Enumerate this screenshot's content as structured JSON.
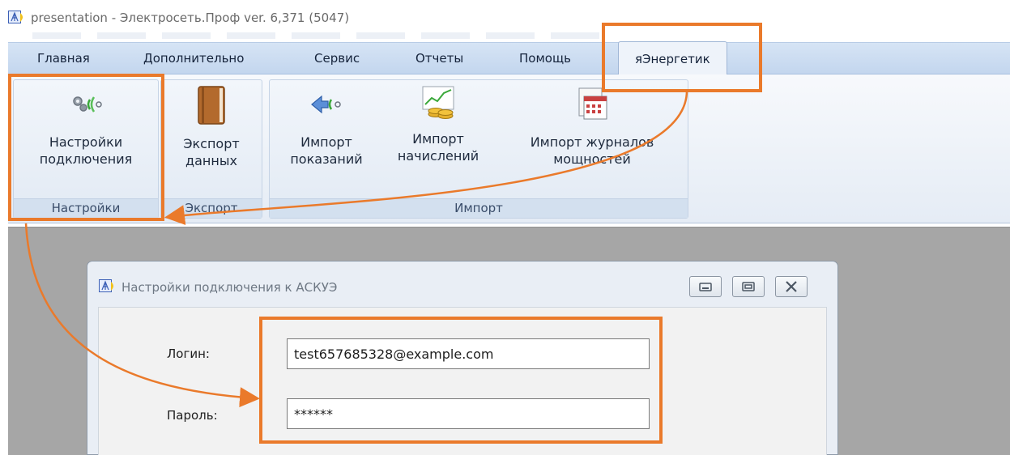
{
  "window": {
    "title": "presentation - Электросеть.Проф ver. 6,371 (5047)"
  },
  "tabs": [
    "Главная",
    "Дополнительно",
    "Сервис",
    "Отчеты",
    "Помощь",
    "яЭнергетик"
  ],
  "active_tab": "яЭнергетик",
  "ribbon": {
    "settings_group": {
      "label": "Настройки",
      "button": {
        "line1": "Настройки",
        "line2": "подключения",
        "icon": "connection-settings-icon"
      }
    },
    "export_group": {
      "label": "Экспорт",
      "button": {
        "line1": "Экспорт",
        "line2": "данных",
        "icon": "book-icon"
      }
    },
    "import_group": {
      "label": "Импорт",
      "buttons": [
        {
          "line1": "Импорт",
          "line2": "показаний",
          "icon": "import-arrow-icon"
        },
        {
          "line1": "Импорт",
          "line2": "начислений",
          "icon": "chart-coins-icon"
        },
        {
          "line1": "Импорт журналов",
          "line2": "мощностей",
          "icon": "calendar-icon"
        }
      ]
    }
  },
  "dialog": {
    "title": "Настройки подключения к АСКУЭ",
    "login_label": "Логин:",
    "login_value": "test657685328@example.com",
    "password_label": "Пароль:",
    "password_value": "******"
  },
  "colors": {
    "highlight": "#ea7a2b",
    "ribbon_tab_bg": "#c9dbf0",
    "workspace_bg": "#a6a6a6"
  }
}
